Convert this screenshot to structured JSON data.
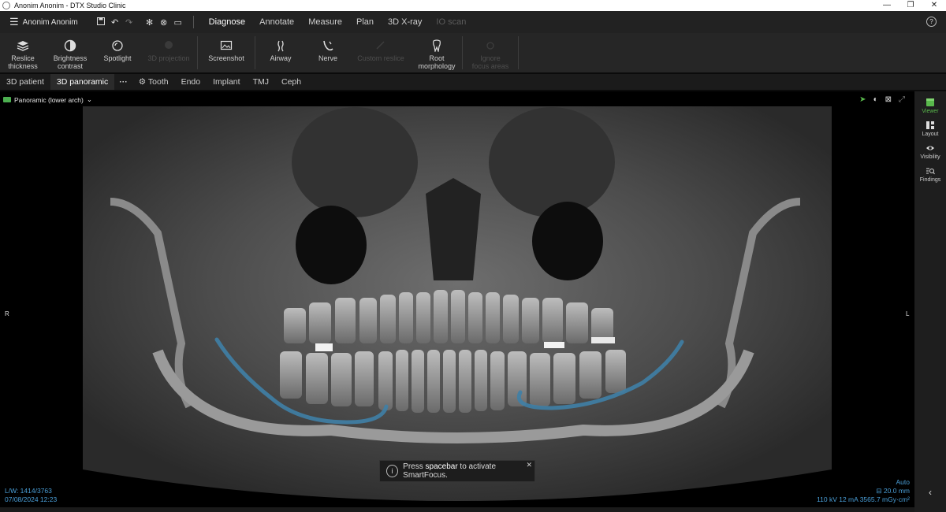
{
  "window": {
    "title": "Anonim Anonim - DTX Studio Clinic",
    "controls": [
      "—",
      "❐",
      "✕"
    ]
  },
  "menubar": {
    "user": "Anonim Anonim",
    "tabs": [
      {
        "label": "Diagnose",
        "state": "active"
      },
      {
        "label": "Annotate",
        "state": "normal"
      },
      {
        "label": "Measure",
        "state": "normal"
      },
      {
        "label": "Plan",
        "state": "normal"
      },
      {
        "label": "3D X-ray",
        "state": "normal"
      },
      {
        "label": "IO scan",
        "state": "disabled"
      }
    ]
  },
  "ribbon": {
    "tools": [
      {
        "label": "Reslice\nthickness",
        "icon": "layers-icon"
      },
      {
        "label": "Brightness\ncontrast",
        "icon": "contrast-icon"
      },
      {
        "label": "Spotlight",
        "icon": "spotlight-icon"
      },
      {
        "label": "3D projection",
        "icon": "projection-icon",
        "disabled": true
      },
      {
        "label": "Screenshot",
        "icon": "screenshot-icon"
      },
      {
        "label": "Airway",
        "icon": "airway-icon"
      },
      {
        "label": "Nerve",
        "icon": "nerve-icon"
      },
      {
        "label": "Custom reslice",
        "icon": "reslice-icon",
        "disabled": true
      },
      {
        "label": "Root\nmorphology",
        "icon": "tooth-icon"
      },
      {
        "label": "Ignore\nfocus areas",
        "icon": "focus-icon",
        "disabled": true
      }
    ]
  },
  "viewtabs": {
    "tabs": [
      "3D patient",
      "3D panoramic"
    ],
    "more": "···",
    "extra": [
      "Tooth",
      "Endo",
      "Implant",
      "TMJ",
      "Ceph"
    ]
  },
  "viewer": {
    "view_selector": "Panoramic (lower arch)",
    "side_left": "R",
    "side_right": "L",
    "toast": {
      "text_before": "Press ",
      "key": "spacebar",
      "text_after": " to activate SmartFocus."
    },
    "lw": "L/W: 1414/3763",
    "date": "07/08/2024 12:23",
    "auto": "Auto",
    "thickness": "20.0 mm",
    "exposure": "110 kV  12 mA  3565.7 mGy·cm²",
    "colors": {
      "overlay": "#3f7fa6",
      "accent_green": "#59b94c",
      "info_text": "#4a9fd8"
    }
  },
  "right_panel": {
    "items": [
      {
        "label": "Viewer",
        "icon": "viewer-icon",
        "active": true
      },
      {
        "label": "Layout",
        "icon": "layout-icon"
      },
      {
        "label": "Visibility",
        "icon": "eye-icon"
      },
      {
        "label": "Findings",
        "icon": "findings-icon"
      }
    ]
  }
}
